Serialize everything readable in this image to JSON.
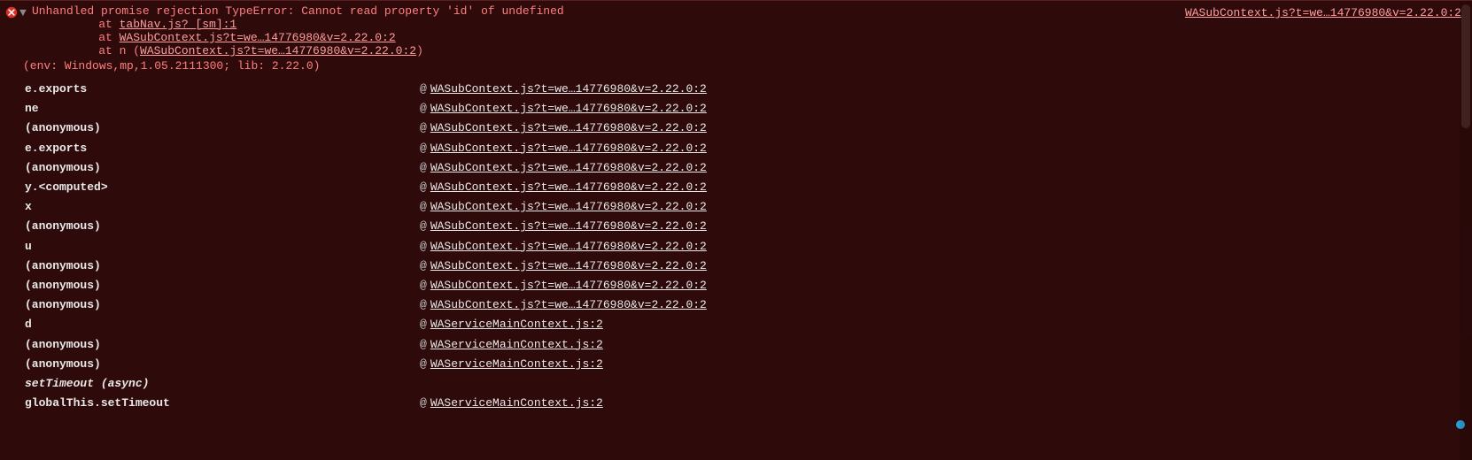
{
  "error": {
    "message": "Unhandled promise rejection TypeError: Cannot read property 'id' of undefined",
    "sourceLink": "WASubContext.js?t=we…14776980&v=2.22.0:2",
    "stack": [
      {
        "prefix": "    at ",
        "link": "tabNav.js? [sm]:1",
        "suffix": ""
      },
      {
        "prefix": "    at ",
        "link": "WASubContext.js?t=we…14776980&v=2.22.0:2",
        "suffix": ""
      },
      {
        "prefix": "    at n (",
        "link": "WASubContext.js?t=we…14776980&v=2.22.0:2",
        "suffix": ")"
      }
    ],
    "env": "(env: Windows,mp,1.05.2111300; lib: 2.22.0)"
  },
  "trace": [
    {
      "fn": "e.exports",
      "loc": "WASubContext.js?t=we…14776980&v=2.22.0:2"
    },
    {
      "fn": "ne",
      "loc": "WASubContext.js?t=we…14776980&v=2.22.0:2"
    },
    {
      "fn": "(anonymous)",
      "loc": "WASubContext.js?t=we…14776980&v=2.22.0:2"
    },
    {
      "fn": "e.exports",
      "loc": "WASubContext.js?t=we…14776980&v=2.22.0:2"
    },
    {
      "fn": "(anonymous)",
      "loc": "WASubContext.js?t=we…14776980&v=2.22.0:2"
    },
    {
      "fn": "y.<computed>",
      "loc": "WASubContext.js?t=we…14776980&v=2.22.0:2"
    },
    {
      "fn": "x",
      "loc": "WASubContext.js?t=we…14776980&v=2.22.0:2"
    },
    {
      "fn": "(anonymous)",
      "loc": "WASubContext.js?t=we…14776980&v=2.22.0:2"
    },
    {
      "fn": "u",
      "loc": "WASubContext.js?t=we…14776980&v=2.22.0:2"
    },
    {
      "fn": "(anonymous)",
      "loc": "WASubContext.js?t=we…14776980&v=2.22.0:2"
    },
    {
      "fn": "(anonymous)",
      "loc": "WASubContext.js?t=we…14776980&v=2.22.0:2"
    },
    {
      "fn": "(anonymous)",
      "loc": "WASubContext.js?t=we…14776980&v=2.22.0:2"
    },
    {
      "fn": "d",
      "loc": "WAServiceMainContext.js:2"
    },
    {
      "fn": "(anonymous)",
      "loc": "WAServiceMainContext.js:2"
    },
    {
      "fn": "(anonymous)",
      "loc": "WAServiceMainContext.js:2"
    },
    {
      "async": true,
      "label": "setTimeout (async)"
    },
    {
      "fn": "globalThis.setTimeout",
      "loc": "WAServiceMainContext.js:2"
    }
  ],
  "at_symbol": "@"
}
